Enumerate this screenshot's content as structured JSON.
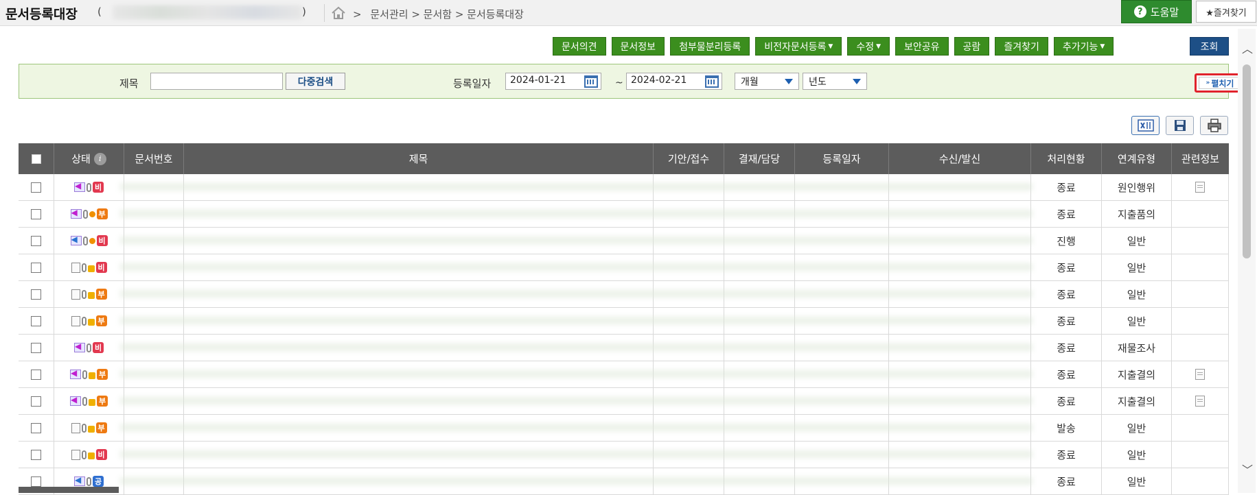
{
  "header": {
    "title": "문서등록대장",
    "paren_open": "(",
    "paren_close": ")",
    "breadcrumb": "문서관리 > 문서함 > 문서등록대장",
    "breadcrumb_sep": ">",
    "help_label": "도움말",
    "favorite_label": "★즐겨찾기"
  },
  "toolbar": {
    "buttons": [
      {
        "label": "문서의견",
        "caret": false
      },
      {
        "label": "문서정보",
        "caret": false
      },
      {
        "label": "첨부물분리등록",
        "caret": false
      },
      {
        "label": "비전자문서등록",
        "caret": true
      },
      {
        "label": "수정",
        "caret": true
      },
      {
        "label": "보안공유",
        "caret": false
      },
      {
        "label": "공람",
        "caret": false
      },
      {
        "label": "즐겨찾기",
        "caret": false
      },
      {
        "label": "추가기능",
        "caret": true
      }
    ],
    "search_label": "조회"
  },
  "search": {
    "title_label": "제목",
    "title_value": "",
    "multi_search_label": "다중검색",
    "date_label": "등록일자",
    "date_from": "2024-01-21",
    "date_to": "2024-02-21",
    "tilde": "~",
    "period_select": "개월",
    "year_select": "년도",
    "expand_label": "펼치기"
  },
  "table": {
    "columns": [
      "상태",
      "문서번호",
      "제목",
      "기안/접수",
      "결재/담당",
      "등록일자",
      "수신/발신",
      "처리현황",
      "연계유형",
      "관련정보"
    ],
    "rows": [
      {
        "icon": "in",
        "clip": true,
        "dot": false,
        "lock": false,
        "badge": "비",
        "badge_color": "red",
        "status": "종료",
        "link_type": "원인행위",
        "related": true
      },
      {
        "icon": "in",
        "clip": true,
        "dot": true,
        "lock": false,
        "badge": "부",
        "badge_color": "orange",
        "status": "종료",
        "link_type": "지출품의",
        "related": false
      },
      {
        "icon": "out",
        "clip": true,
        "dot": true,
        "lock": false,
        "badge": "비",
        "badge_color": "red",
        "status": "진행",
        "link_type": "일반",
        "related": false
      },
      {
        "icon": "doc",
        "clip": true,
        "dot": false,
        "lock": true,
        "badge": "비",
        "badge_color": "red",
        "status": "종료",
        "link_type": "일반",
        "related": false
      },
      {
        "icon": "doc",
        "clip": true,
        "dot": false,
        "lock": true,
        "badge": "부",
        "badge_color": "orange",
        "status": "종료",
        "link_type": "일반",
        "related": false
      },
      {
        "icon": "doc",
        "clip": true,
        "dot": false,
        "lock": true,
        "badge": "부",
        "badge_color": "orange",
        "status": "종료",
        "link_type": "일반",
        "related": false
      },
      {
        "icon": "in",
        "clip": true,
        "dot": false,
        "lock": false,
        "badge": "비",
        "badge_color": "red",
        "status": "종료",
        "link_type": "재물조사",
        "related": false
      },
      {
        "icon": "in",
        "clip": true,
        "dot": false,
        "lock": true,
        "badge": "부",
        "badge_color": "orange",
        "status": "종료",
        "link_type": "지출결의",
        "related": true
      },
      {
        "icon": "in",
        "clip": true,
        "dot": false,
        "lock": true,
        "badge": "부",
        "badge_color": "orange",
        "status": "종료",
        "link_type": "지출결의",
        "related": true
      },
      {
        "icon": "doc",
        "clip": true,
        "dot": false,
        "lock": true,
        "badge": "부",
        "badge_color": "orange",
        "status": "발송",
        "link_type": "일반",
        "related": false
      },
      {
        "icon": "doc",
        "clip": true,
        "dot": false,
        "lock": true,
        "badge": "비",
        "badge_color": "red",
        "status": "종료",
        "link_type": "일반",
        "related": false
      },
      {
        "icon": "out",
        "clip": true,
        "dot": false,
        "lock": false,
        "badge": "공",
        "badge_color": "blue",
        "status": "종료",
        "link_type": "일반",
        "related": false
      }
    ]
  },
  "colors": {
    "green_button": "#3b8e1e",
    "blue_button": "#1d4f86",
    "header_bg": "#5c5c5c",
    "search_panel_bg": "#eef6e2",
    "highlight_border": "#e0222b"
  }
}
